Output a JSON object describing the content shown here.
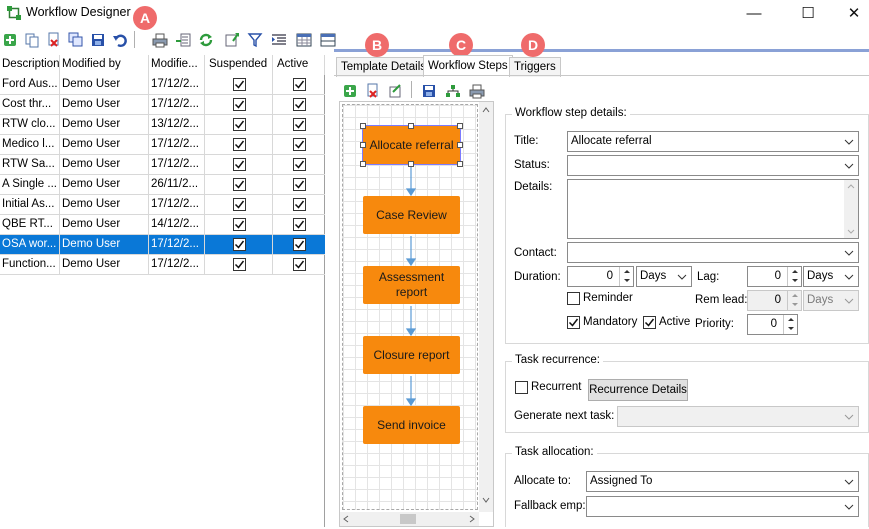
{
  "window": {
    "title": "Workflow Designer",
    "minimize": "—",
    "maximize": "☐",
    "close": "✕"
  },
  "markers": [
    "A",
    "B",
    "C",
    "D"
  ],
  "toolbar": {
    "icons": [
      "add-icon",
      "copy-icon",
      "delete-icon",
      "duplicate-icon",
      "save-icon",
      "undo-icon",
      "print-icon",
      "export-icon",
      "refresh-icon",
      "import-icon",
      "filter-icon",
      "indent-icon",
      "grid-icon",
      "panel-icon"
    ]
  },
  "grid": {
    "columns": [
      "Description",
      "Modified by",
      "Modifie...",
      "Suspended",
      "Active"
    ],
    "rows": [
      {
        "description": "Ford Aus...",
        "modified_by": "Demo User",
        "modified": "17/12/2...",
        "suspended": true,
        "active": true
      },
      {
        "description": "Cost thr...",
        "modified_by": "Demo User",
        "modified": "17/12/2...",
        "suspended": true,
        "active": true
      },
      {
        "description": "RTW clo...",
        "modified_by": "Demo User",
        "modified": "13/12/2...",
        "suspended": true,
        "active": true
      },
      {
        "description": "Medico l...",
        "modified_by": "Demo User",
        "modified": "17/12/2...",
        "suspended": true,
        "active": true
      },
      {
        "description": "RTW Sa...",
        "modified_by": "Demo User",
        "modified": "17/12/2...",
        "suspended": true,
        "active": true
      },
      {
        "description": "A Single ...",
        "modified_by": "Demo User",
        "modified": "26/11/2...",
        "suspended": true,
        "active": true
      },
      {
        "description": "Initial As...",
        "modified_by": "Demo User",
        "modified": "17/12/2...",
        "suspended": true,
        "active": true
      },
      {
        "description": "QBE RT...",
        "modified_by": "Demo User",
        "modified": "14/12/2...",
        "suspended": true,
        "active": true
      },
      {
        "description": "OSA wor...",
        "modified_by": "Demo User",
        "modified": "17/12/2...",
        "suspended": true,
        "active": true,
        "selected": true
      },
      {
        "description": "Function...",
        "modified_by": "Demo User",
        "modified": "17/12/2...",
        "suspended": true,
        "active": true
      }
    ]
  },
  "tabs": [
    {
      "label": "Template Details",
      "active": false
    },
    {
      "label": "Workflow Steps",
      "active": true
    },
    {
      "label": "Triggers",
      "active": false
    }
  ],
  "inner_toolbar": {
    "icons": [
      "add-step-icon",
      "delete-step-icon",
      "connect-icon",
      "save-icon",
      "layout-icon",
      "print-icon"
    ]
  },
  "flow": {
    "nodes": [
      "Allocate referral",
      "Case Review",
      "Assessment report",
      "Closure report",
      "Send invoice"
    ],
    "selected": "Allocate referral"
  },
  "step_details": {
    "group_title": "Workflow step details:",
    "title_label": "Title:",
    "title_value": "Allocate referral",
    "status_label": "Status:",
    "status_value": "",
    "details_label": "Details:",
    "contact_label": "Contact:",
    "contact_value": "",
    "duration_label": "Duration:",
    "duration_value": "0",
    "duration_unit": "Days",
    "lag_label": "Lag:",
    "lag_value": "0",
    "lag_unit": "Days",
    "reminder_label": "Reminder",
    "reminder_checked": false,
    "rem_lead_label": "Rem lead:",
    "rem_lead_value": "0",
    "rem_lead_unit": "Days",
    "mandatory_label": "Mandatory",
    "mandatory_checked": true,
    "active_label": "Active",
    "active_checked": true,
    "priority_label": "Priority:",
    "priority_value": "0"
  },
  "recurrence": {
    "group_title": "Task recurrence:",
    "recurrent_label": "Recurrent",
    "recurrent_checked": false,
    "details_button": "Recurrence Details",
    "generate_label": "Generate next task:",
    "generate_value": ""
  },
  "allocation": {
    "group_title": "Task allocation:",
    "allocate_label": "Allocate to:",
    "allocate_value": "Assigned To",
    "fallback_label": "Fallback emp:",
    "fallback_value": ""
  }
}
